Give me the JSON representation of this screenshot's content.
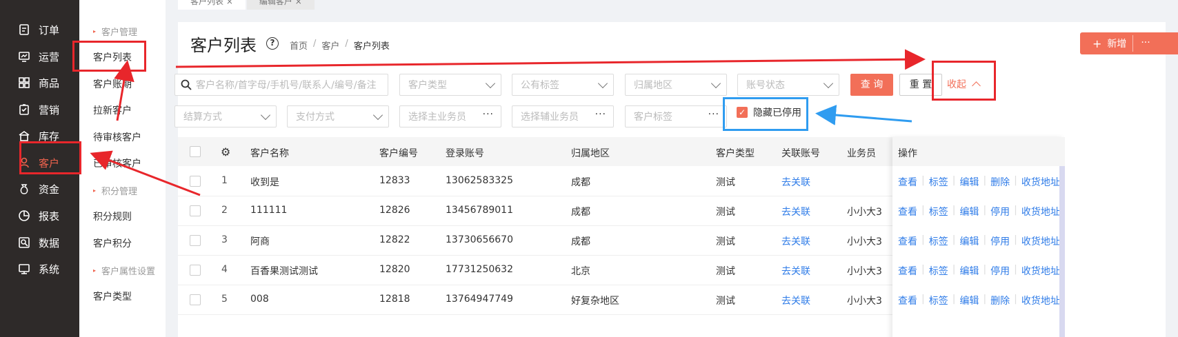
{
  "tabs": [
    "客户列表",
    "编辑客户"
  ],
  "nav": [
    {
      "label": "订单",
      "icon": "order-icon"
    },
    {
      "label": "运营",
      "icon": "operation-icon"
    },
    {
      "label": "商品",
      "icon": "goods-icon"
    },
    {
      "label": "营销",
      "icon": "marketing-icon"
    },
    {
      "label": "库存",
      "icon": "inventory-icon"
    },
    {
      "label": "客户",
      "icon": "customer-icon"
    },
    {
      "label": "资金",
      "icon": "funds-icon"
    },
    {
      "label": "报表",
      "icon": "report-icon"
    },
    {
      "label": "数据",
      "icon": "data-icon"
    },
    {
      "label": "系统",
      "icon": "system-icon"
    }
  ],
  "subnav": {
    "group1": "客户管理",
    "items1": [
      "客户列表",
      "客户账期",
      "拉新客户",
      "待审核客户",
      "已审核客户"
    ],
    "group2": "积分管理",
    "items2": [
      "积分规则",
      "客户积分"
    ],
    "group3": "客户属性设置",
    "items3": [
      "客户类型"
    ]
  },
  "page": {
    "title": "客户列表",
    "breadcrumb": [
      "首页",
      "客户",
      "客户列表"
    ],
    "new_label": "新增",
    "more_label": "···"
  },
  "filters": {
    "search_placeholder": "客户名称/首字母/手机号/联系人/编号/备注",
    "customer_type": "客户类型",
    "public_tag": "公有标签",
    "region": "归属地区",
    "account_status": "账号状态",
    "query": "查 询",
    "reset": "重 置",
    "collapse": "收起",
    "settlement": "结算方式",
    "payment": "支付方式",
    "main_salesman": "选择主业务员",
    "assist_salesman": "选择辅业务员",
    "customer_tag": "客户标签",
    "hide_disabled": "隐藏已停用"
  },
  "table": {
    "headers": [
      "客户名称",
      "客户编号",
      "登录账号",
      "归属地区",
      "客户类型",
      "关联账号",
      "业务员",
      "操作"
    ],
    "rows": [
      {
        "idx": "1",
        "name": "收到是",
        "code": "12833",
        "account": "13062583325",
        "region": "成都",
        "type": "测试",
        "link": "去关联",
        "sales": "",
        "ops": [
          "查看",
          "标签",
          "编辑",
          "删除",
          "收货地址"
        ]
      },
      {
        "idx": "2",
        "name": "111111",
        "code": "12826",
        "account": "13456789011",
        "region": "成都",
        "type": "测试",
        "link": "去关联",
        "sales": "小小大3",
        "ops": [
          "查看",
          "标签",
          "编辑",
          "停用",
          "收货地址"
        ]
      },
      {
        "idx": "3",
        "name": "阿商",
        "code": "12822",
        "account": "13730656670",
        "region": "成都",
        "type": "测试",
        "link": "去关联",
        "sales": "小小大3",
        "ops": [
          "查看",
          "标签",
          "编辑",
          "停用",
          "收货地址"
        ]
      },
      {
        "idx": "4",
        "name": "百香果测试测试",
        "code": "12820",
        "account": "17731250632",
        "region": "北京",
        "type": "测试",
        "link": "去关联",
        "sales": "小小大3",
        "ops": [
          "查看",
          "标签",
          "编辑",
          "停用",
          "收货地址"
        ]
      },
      {
        "idx": "5",
        "name": "008",
        "code": "12818",
        "account": "13764947749",
        "region": "好复杂地区",
        "type": "测试",
        "link": "去关联",
        "sales": "小小大3",
        "ops": [
          "查看",
          "标签",
          "编辑",
          "删除",
          "收货地址"
        ]
      }
    ]
  },
  "colors": {
    "accent": "#f26f58",
    "link": "#2f7ce8",
    "annotation_red": "#e8262b",
    "annotation_blue": "#2f9cf0",
    "nav_bg": "#2e2a29"
  }
}
